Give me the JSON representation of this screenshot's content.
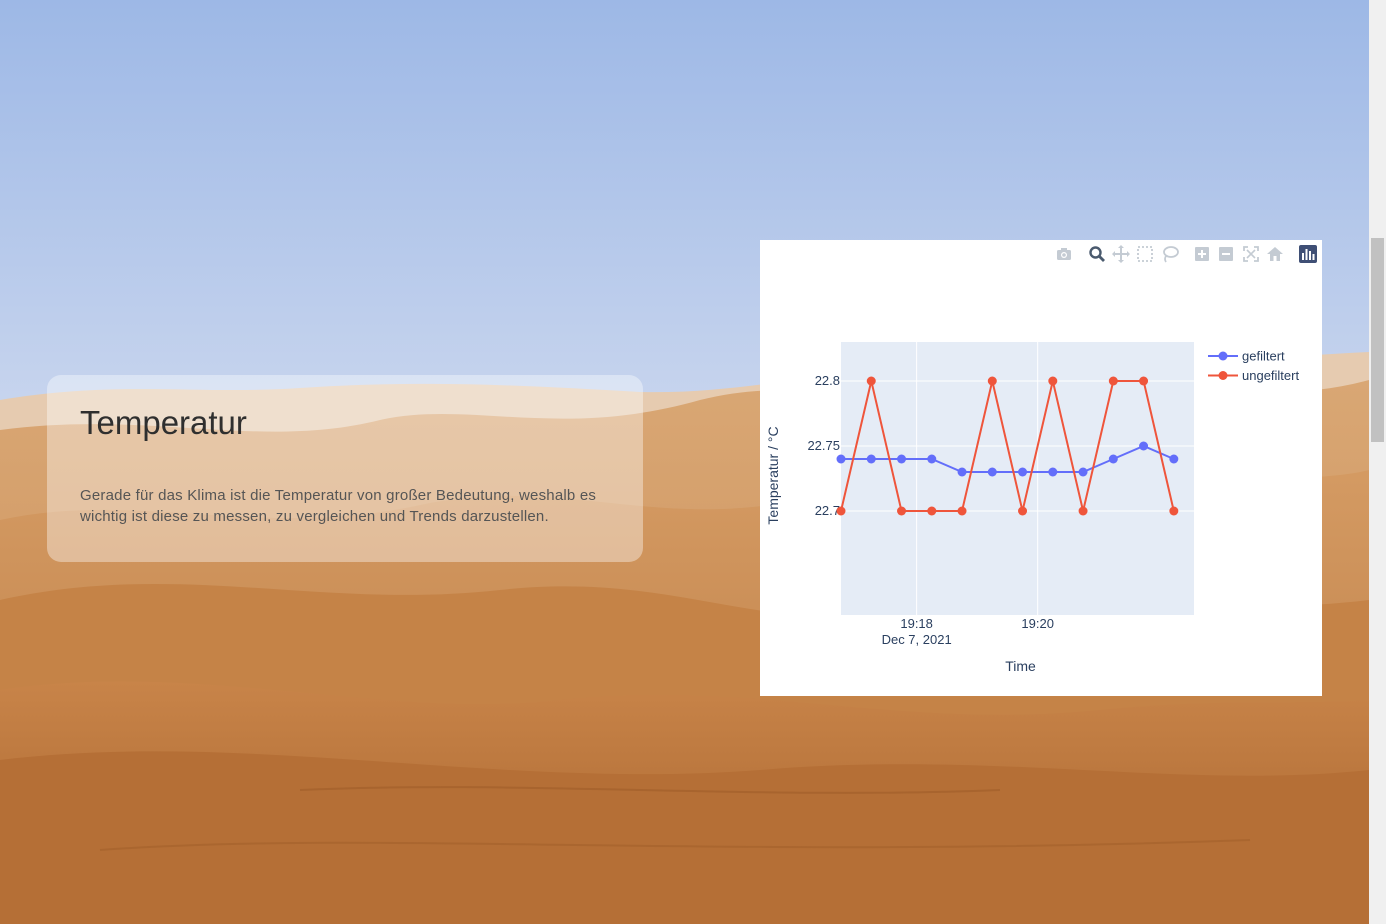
{
  "card": {
    "title": "Temperatur",
    "text": "Gerade für das Klima ist die Temperatur von großer Bedeutung, weshalb es wichtig ist diese zu messen, zu vergleichen und Trends darzustellen."
  },
  "modebar": {
    "icons": [
      "camera-icon",
      "zoom-icon",
      "pan-icon",
      "box-select-icon",
      "lasso-icon",
      "zoom-in-icon",
      "zoom-out-icon",
      "autoscale-icon",
      "reset-axes-icon",
      "plotly-logo-icon"
    ]
  },
  "colors": {
    "gefiltert": "#636efa",
    "ungefiltert": "#ef553b",
    "plot_bg": "#e5ecf6",
    "grid": "#ffffff",
    "text": "#2a3f5f"
  },
  "chart_data": {
    "type": "line",
    "xlabel": "Time",
    "ylabel": "Temperatur / °C",
    "x": [
      "19:16:45",
      "19:17:15",
      "19:17:45",
      "19:18:15",
      "19:18:45",
      "19:19:15",
      "19:19:45",
      "19:20:15",
      "19:20:45",
      "19:21:15",
      "19:21:45",
      "19:22:15"
    ],
    "xlim": [
      "19:16:45",
      "19:22:35"
    ],
    "ylim": [
      22.62,
      22.83
    ],
    "x_ticks": [
      {
        "value": "19:18",
        "label": "19:18",
        "sublabel": "Dec 7, 2021"
      },
      {
        "value": "19:20",
        "label": "19:20",
        "sublabel": ""
      }
    ],
    "y_ticks": [
      22.7,
      22.75,
      22.8
    ],
    "y_tick_labels": [
      "22.7",
      "22.75",
      "22.8"
    ],
    "series": [
      {
        "name": "gefiltert",
        "values": [
          22.74,
          22.74,
          22.74,
          22.74,
          22.73,
          22.73,
          22.73,
          22.73,
          22.73,
          22.74,
          22.75,
          22.74
        ]
      },
      {
        "name": "ungefiltert",
        "values": [
          22.7,
          22.8,
          22.7,
          22.7,
          22.7,
          22.8,
          22.7,
          22.8,
          22.7,
          22.8,
          22.8,
          22.7
        ]
      }
    ],
    "grid": true,
    "legend": "top-right",
    "mode": "lines+markers"
  }
}
